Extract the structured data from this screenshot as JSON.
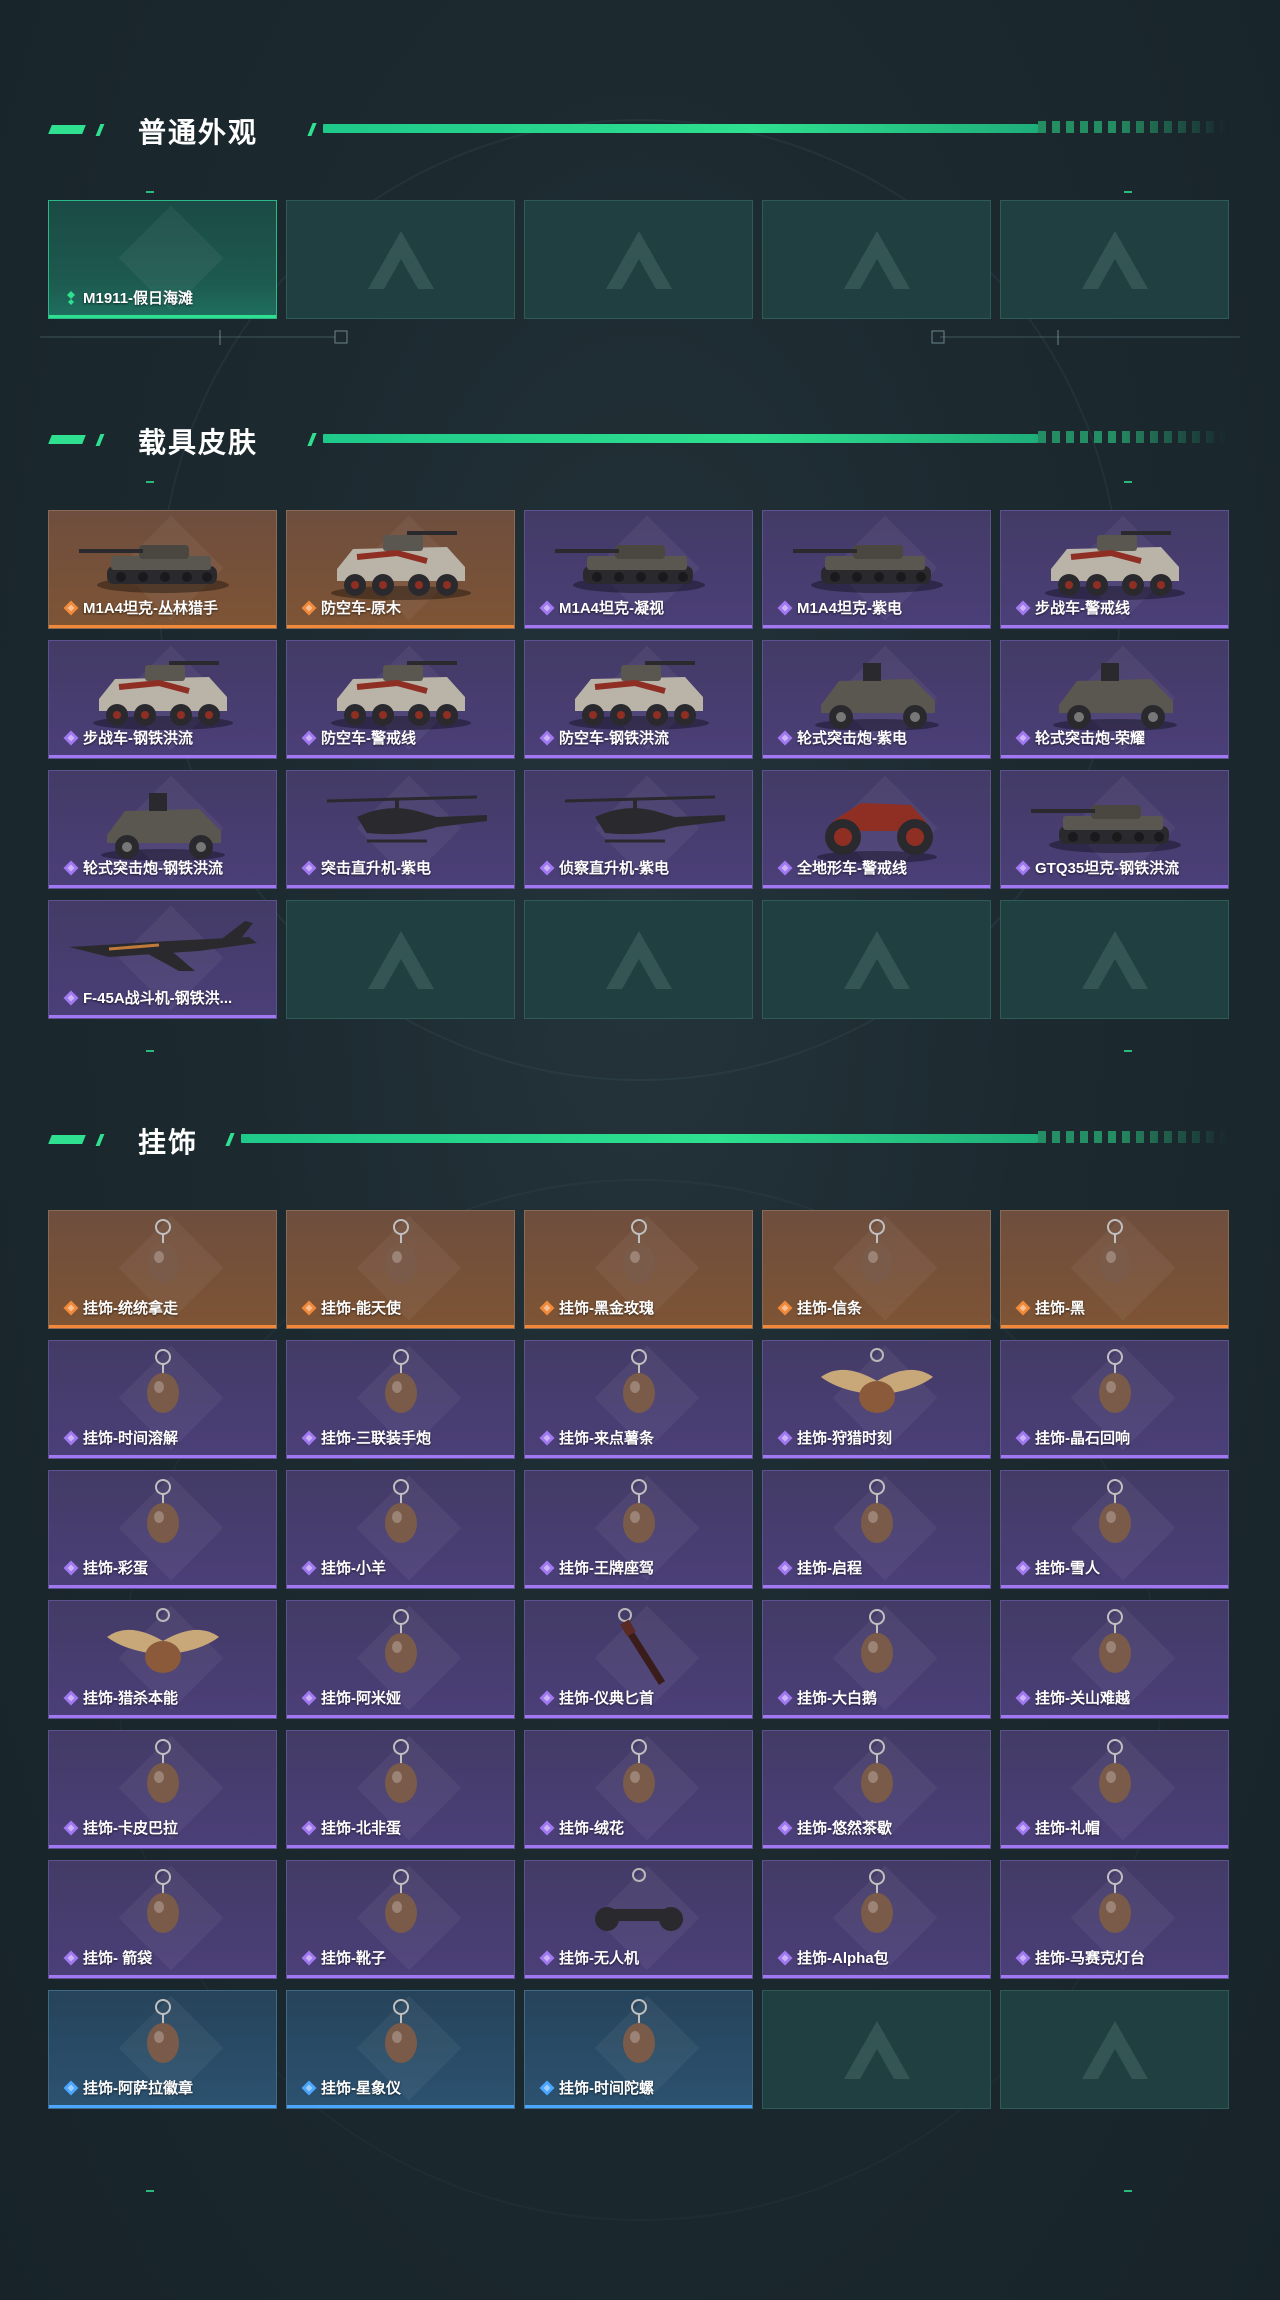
{
  "sections": [
    {
      "title": "普通外观",
      "items": [
        {
          "label": "M1911-假日海滩",
          "rarity": "green",
          "icon": "pistol-icon"
        },
        {
          "label": "",
          "rarity": "empty"
        },
        {
          "label": "",
          "rarity": "empty"
        },
        {
          "label": "",
          "rarity": "empty"
        },
        {
          "label": "",
          "rarity": "empty"
        }
      ]
    },
    {
      "title": "载具皮肤",
      "items": [
        {
          "label": "M1A4坦克-丛林猎手",
          "rarity": "orange",
          "icon": "tank-icon"
        },
        {
          "label": "防空车-原木",
          "rarity": "orange",
          "icon": "armored-car-icon"
        },
        {
          "label": "M1A4坦克-凝视",
          "rarity": "purple",
          "icon": "tank-icon"
        },
        {
          "label": "M1A4坦克-紫电",
          "rarity": "purple",
          "icon": "tank-icon"
        },
        {
          "label": "步战车-警戒线",
          "rarity": "purple",
          "icon": "armored-car-icon"
        },
        {
          "label": "步战车-钢铁洪流",
          "rarity": "purple",
          "icon": "armored-car-icon"
        },
        {
          "label": "防空车-警戒线",
          "rarity": "purple",
          "icon": "armored-car-icon"
        },
        {
          "label": "防空车-钢铁洪流",
          "rarity": "purple",
          "icon": "armored-car-icon"
        },
        {
          "label": "轮式突击炮-紫电",
          "rarity": "purple",
          "icon": "buggy-icon"
        },
        {
          "label": "轮式突击炮-荣耀",
          "rarity": "purple",
          "icon": "buggy-icon"
        },
        {
          "label": "轮式突击炮-钢铁洪流",
          "rarity": "purple",
          "icon": "buggy-icon"
        },
        {
          "label": "突击直升机-紫电",
          "rarity": "purple",
          "icon": "helicopter-icon"
        },
        {
          "label": "侦察直升机-紫电",
          "rarity": "purple",
          "icon": "helicopter-icon"
        },
        {
          "label": "全地形车-警戒线",
          "rarity": "purple",
          "icon": "atv-icon"
        },
        {
          "label": "GTQ35坦克-钢铁洪流",
          "rarity": "purple",
          "icon": "tank-icon"
        },
        {
          "label": "F-45A战斗机-钢铁洪...",
          "rarity": "purple",
          "icon": "jet-icon"
        },
        {
          "label": "",
          "rarity": "empty"
        },
        {
          "label": "",
          "rarity": "empty"
        },
        {
          "label": "",
          "rarity": "empty"
        },
        {
          "label": "",
          "rarity": "empty"
        }
      ]
    },
    {
      "title": "挂饰",
      "items": [
        {
          "label": "挂饰-统统拿走",
          "rarity": "orange",
          "icon": "charm-icon"
        },
        {
          "label": "挂饰-能天使",
          "rarity": "orange",
          "icon": "charm-icon"
        },
        {
          "label": "挂饰-黑金玫瑰",
          "rarity": "orange",
          "icon": "charm-icon"
        },
        {
          "label": "挂饰-信条",
          "rarity": "orange",
          "icon": "charm-icon"
        },
        {
          "label": "挂饰-黑",
          "rarity": "orange",
          "icon": "charm-icon"
        },
        {
          "label": "挂饰-时间溶解",
          "rarity": "purple",
          "icon": "charm-icon"
        },
        {
          "label": "挂饰-三联装手炮",
          "rarity": "purple",
          "icon": "charm-icon"
        },
        {
          "label": "挂饰-来点薯条",
          "rarity": "purple",
          "icon": "charm-icon"
        },
        {
          "label": "挂饰-狩猎时刻",
          "rarity": "purple",
          "icon": "antler-charm-icon"
        },
        {
          "label": "挂饰-晶石回响",
          "rarity": "purple",
          "icon": "charm-icon"
        },
        {
          "label": "挂饰-彩蛋",
          "rarity": "purple",
          "icon": "charm-icon"
        },
        {
          "label": "挂饰-小羊",
          "rarity": "purple",
          "icon": "charm-icon"
        },
        {
          "label": "挂饰-王牌座驾",
          "rarity": "purple",
          "icon": "charm-icon"
        },
        {
          "label": "挂饰-启程",
          "rarity": "purple",
          "icon": "charm-icon"
        },
        {
          "label": "挂饰-雪人",
          "rarity": "purple",
          "icon": "charm-icon"
        },
        {
          "label": "挂饰-猎杀本能",
          "rarity": "purple",
          "icon": "antler-charm-icon"
        },
        {
          "label": "挂饰-阿米娅",
          "rarity": "purple",
          "icon": "charm-icon"
        },
        {
          "label": "挂饰-仪典匕首",
          "rarity": "purple",
          "icon": "dagger-charm-icon"
        },
        {
          "label": "挂饰-大白鹅",
          "rarity": "purple",
          "icon": "charm-icon"
        },
        {
          "label": "挂饰-关山难越",
          "rarity": "purple",
          "icon": "charm-icon"
        },
        {
          "label": "挂饰-卡皮巴拉",
          "rarity": "purple",
          "icon": "charm-icon"
        },
        {
          "label": "挂饰-北非蛋",
          "rarity": "purple",
          "icon": "charm-icon"
        },
        {
          "label": "挂饰-绒花",
          "rarity": "purple",
          "icon": "charm-icon"
        },
        {
          "label": "挂饰-悠然茶歇",
          "rarity": "purple",
          "icon": "charm-icon"
        },
        {
          "label": "挂饰-礼帽",
          "rarity": "purple",
          "icon": "charm-icon"
        },
        {
          "label": "挂饰- 箭袋",
          "rarity": "purple",
          "icon": "charm-icon"
        },
        {
          "label": "挂饰-靴子",
          "rarity": "purple",
          "icon": "charm-icon"
        },
        {
          "label": "挂饰-无人机",
          "rarity": "purple",
          "icon": "drone-charm-icon"
        },
        {
          "label": "挂饰-Alpha包",
          "rarity": "purple",
          "icon": "charm-icon"
        },
        {
          "label": "挂饰-马赛克灯台",
          "rarity": "purple",
          "icon": "charm-icon"
        },
        {
          "label": "挂饰-阿萨拉徽章",
          "rarity": "blue",
          "icon": "charm-icon"
        },
        {
          "label": "挂饰-星象仪",
          "rarity": "blue",
          "icon": "charm-icon"
        },
        {
          "label": "挂饰-时间陀螺",
          "rarity": "blue",
          "icon": "charm-icon"
        },
        {
          "label": "",
          "rarity": "empty"
        },
        {
          "label": "",
          "rarity": "empty"
        }
      ]
    }
  ],
  "colors": {
    "accent": "#2ee08f",
    "orange": "#f08a3a",
    "purple": "#a178f2",
    "blue": "#4aa6ff",
    "green": "#2ee08f",
    "empty": "#1f3f40"
  }
}
